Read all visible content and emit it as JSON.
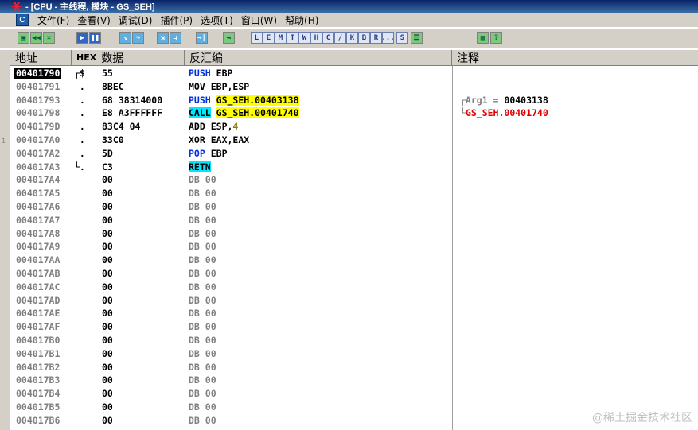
{
  "window": {
    "title": "- [CPU - 主线程, 模块 - GS_SEH]"
  },
  "menu": [
    "文件(F)",
    "查看(V)",
    "调试(D)",
    "插件(P)",
    "选项(T)",
    "窗口(W)",
    "帮助(H)"
  ],
  "menu_icon": "C",
  "toolbar": {
    "buttons": [
      {
        "icon": "open-icon",
        "label": "▣"
      },
      {
        "icon": "rewind-icon",
        "label": "◀◀"
      },
      {
        "icon": "close-icon",
        "label": "✕"
      },
      {
        "icon": "run-icon",
        "label": "▶"
      },
      {
        "icon": "pause-icon",
        "label": "❚❚"
      },
      {
        "icon": "step-into-icon",
        "label": "↘"
      },
      {
        "icon": "step-over-icon",
        "label": "↷"
      },
      {
        "icon": "trace-into-icon",
        "label": "⇲"
      },
      {
        "icon": "trace-over-icon",
        "label": "⇉"
      },
      {
        "icon": "execute-till-return-icon",
        "label": "→|"
      },
      {
        "icon": "goto-icon",
        "label": "⇥"
      },
      {
        "icon": "letter-L-icon",
        "label": "L"
      },
      {
        "icon": "letter-E-icon",
        "label": "E"
      },
      {
        "icon": "letter-M-icon",
        "label": "M"
      },
      {
        "icon": "letter-T-icon",
        "label": "T"
      },
      {
        "icon": "letter-W-icon",
        "label": "W"
      },
      {
        "icon": "letter-H-icon",
        "label": "H"
      },
      {
        "icon": "letter-C-icon",
        "label": "C"
      },
      {
        "icon": "letter-slash-icon",
        "label": "/"
      },
      {
        "icon": "letter-K-icon",
        "label": "K"
      },
      {
        "icon": "letter-B-icon",
        "label": "B"
      },
      {
        "icon": "letter-R-icon",
        "label": "R"
      },
      {
        "icon": "letter-dots-icon",
        "label": "..."
      },
      {
        "icon": "letter-S-icon",
        "label": "S"
      },
      {
        "icon": "list-icon",
        "label": "☰"
      },
      {
        "icon": "grid-icon",
        "label": "▦"
      },
      {
        "icon": "help-icon",
        "label": "?"
      }
    ]
  },
  "columns": {
    "address": "地址",
    "hex_prefix": "HEX",
    "hex": "数据",
    "disasm": "反汇编",
    "comment": "注释"
  },
  "rows": [
    {
      "addr": "00401790",
      "bracket": "┌$",
      "hex": "55",
      "mn": "PUSH",
      "ops": "EBP",
      "mnc": "blue",
      "sel": true
    },
    {
      "addr": "00401791",
      "bracket": " .",
      "hex": "8BEC",
      "mn": "MOV",
      "ops": "EBP,ESP"
    },
    {
      "addr": "00401793",
      "bracket": " .",
      "hex": "68 38314000",
      "mn": "PUSH",
      "ops": "GS_SEH.00403138",
      "mnc": "blue",
      "opsc": "y",
      "cmtp": "┌Arg1 = ",
      "cmt": "00403138"
    },
    {
      "addr": "00401798",
      "bracket": " .",
      "hex": "E8 A3FFFFFF",
      "mn": "CALL",
      "ops": "GS_SEH.00401740",
      "mnc": "cy",
      "opsc": "y",
      "cmtp": "└",
      "cmt": "GS_SEH.00401740",
      "cmtc": "red"
    },
    {
      "addr": "0040179D",
      "bracket": " .",
      "hex": "83C4 04",
      "mn": "ADD",
      "ops": "ESP,",
      "imm": "4"
    },
    {
      "addr": "004017A0",
      "bracket": " .",
      "hex": "33C0",
      "mn": "XOR",
      "ops": "EAX,EAX"
    },
    {
      "addr": "004017A2",
      "bracket": " .",
      "hex": "5D",
      "mn": "POP",
      "ops": "EBP",
      "mnc": "blue"
    },
    {
      "addr": "004017A3",
      "bracket": "└.",
      "hex": "C3",
      "mn": "RETN",
      "ops": "",
      "mnc": "cy"
    },
    {
      "addr": "004017A4",
      "hex": "00",
      "mn": "DB",
      "ops": "00",
      "dim": true
    },
    {
      "addr": "004017A5",
      "hex": "00",
      "mn": "DB",
      "ops": "00",
      "dim": true
    },
    {
      "addr": "004017A6",
      "hex": "00",
      "mn": "DB",
      "ops": "00",
      "dim": true
    },
    {
      "addr": "004017A7",
      "hex": "00",
      "mn": "DB",
      "ops": "00",
      "dim": true
    },
    {
      "addr": "004017A8",
      "hex": "00",
      "mn": "DB",
      "ops": "00",
      "dim": true
    },
    {
      "addr": "004017A9",
      "hex": "00",
      "mn": "DB",
      "ops": "00",
      "dim": true
    },
    {
      "addr": "004017AA",
      "hex": "00",
      "mn": "DB",
      "ops": "00",
      "dim": true
    },
    {
      "addr": "004017AB",
      "hex": "00",
      "mn": "DB",
      "ops": "00",
      "dim": true
    },
    {
      "addr": "004017AC",
      "hex": "00",
      "mn": "DB",
      "ops": "00",
      "dim": true
    },
    {
      "addr": "004017AD",
      "hex": "00",
      "mn": "DB",
      "ops": "00",
      "dim": true
    },
    {
      "addr": "004017AE",
      "hex": "00",
      "mn": "DB",
      "ops": "00",
      "dim": true
    },
    {
      "addr": "004017AF",
      "hex": "00",
      "mn": "DB",
      "ops": "00",
      "dim": true
    },
    {
      "addr": "004017B0",
      "hex": "00",
      "mn": "DB",
      "ops": "00",
      "dim": true
    },
    {
      "addr": "004017B1",
      "hex": "00",
      "mn": "DB",
      "ops": "00",
      "dim": true
    },
    {
      "addr": "004017B2",
      "hex": "00",
      "mn": "DB",
      "ops": "00",
      "dim": true
    },
    {
      "addr": "004017B3",
      "hex": "00",
      "mn": "DB",
      "ops": "00",
      "dim": true
    },
    {
      "addr": "004017B4",
      "hex": "00",
      "mn": "DB",
      "ops": "00",
      "dim": true
    },
    {
      "addr": "004017B5",
      "hex": "00",
      "mn": "DB",
      "ops": "00",
      "dim": true
    },
    {
      "addr": "004017B6",
      "hex": "00",
      "mn": "DB",
      "ops": "00",
      "dim": true
    }
  ],
  "left_margin_mark": "1",
  "watermark": "@稀土掘金技术社区"
}
